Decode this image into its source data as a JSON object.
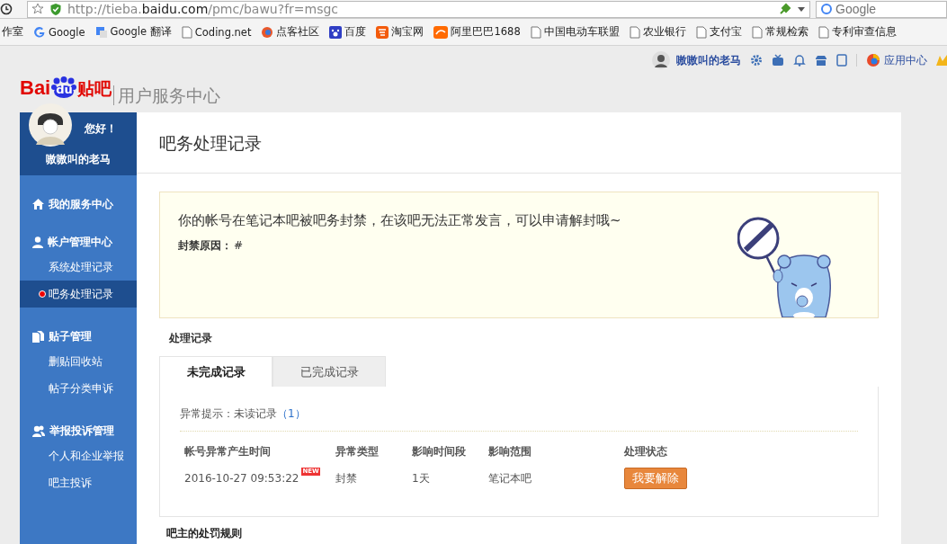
{
  "browser": {
    "url_host": "http://tieba.",
    "url_domain": "baidu.com",
    "url_path": "/pmc/bawu?fr=msgc",
    "search_placeholder": "Google",
    "bookmarks": [
      {
        "label": "作室",
        "kind": "none"
      },
      {
        "label": "Google",
        "kind": "google"
      },
      {
        "label": "Google 翻译",
        "kind": "translate"
      },
      {
        "label": "Coding.net",
        "kind": "page"
      },
      {
        "label": "点客社区",
        "kind": "orb"
      },
      {
        "label": "百度",
        "kind": "paw"
      },
      {
        "label": "淘宝网",
        "kind": "taobao"
      },
      {
        "label": "阿里巴巴1688",
        "kind": "alibaba"
      },
      {
        "label": "中国电动车联盟",
        "kind": "page"
      },
      {
        "label": "农业银行",
        "kind": "page"
      },
      {
        "label": "支付宝",
        "kind": "page"
      },
      {
        "label": "常规检索",
        "kind": "page"
      },
      {
        "label": "专利审查信息",
        "kind": "page"
      }
    ]
  },
  "header": {
    "logo_left": "Bai",
    "logo_paw": "du",
    "logo_right": "贴吧",
    "subtitle": "用户服务中心",
    "user_name": "嗷嗷叫的老马",
    "app_center": "应用中心"
  },
  "sidebar": {
    "greeting": "您好！",
    "user_name": "嗷嗷叫的老马",
    "sections": [
      {
        "title": "我的服务中心",
        "kind": "home"
      },
      {
        "title": "帐户管理中心",
        "kind": "person",
        "items": [
          {
            "label": "系统处理记录",
            "selected": false
          },
          {
            "label": "吧务处理记录",
            "selected": true
          }
        ]
      },
      {
        "title": "贴子管理",
        "kind": "docs",
        "items": [
          {
            "label": "删贴回收站",
            "selected": false
          },
          {
            "label": "帖子分类申诉",
            "selected": false
          }
        ]
      },
      {
        "title": "举报投诉管理",
        "kind": "people",
        "items": [
          {
            "label": "个人和企业举报",
            "selected": false
          },
          {
            "label": "吧主投诉",
            "selected": false
          }
        ]
      }
    ]
  },
  "main": {
    "title": "吧务处理记录",
    "notice": {
      "message": "你的帐号在笔记本吧被吧务封禁，在该吧无法正常发言，可以申请解封哦~",
      "reason_label": "封禁原因：",
      "reason": "#"
    },
    "records": {
      "heading": "处理记录",
      "tabs": [
        {
          "label": "未完成记录",
          "selected": true
        },
        {
          "label": "已完成记录",
          "selected": false
        }
      ],
      "hint_label": "异常提示：未读记录",
      "hint_count": "（1）",
      "columns": [
        "帐号异常产生时间",
        "异常类型",
        "影响时间段",
        "影响范围",
        "处理状态"
      ],
      "rows": [
        {
          "time": "2016-10-27 09:53:22",
          "badge": "NEW",
          "type": "封禁",
          "duration": "1天",
          "scope": "笔记本吧",
          "action": "我要解除"
        }
      ]
    },
    "rules_heading": "吧主的处罚规则"
  }
}
